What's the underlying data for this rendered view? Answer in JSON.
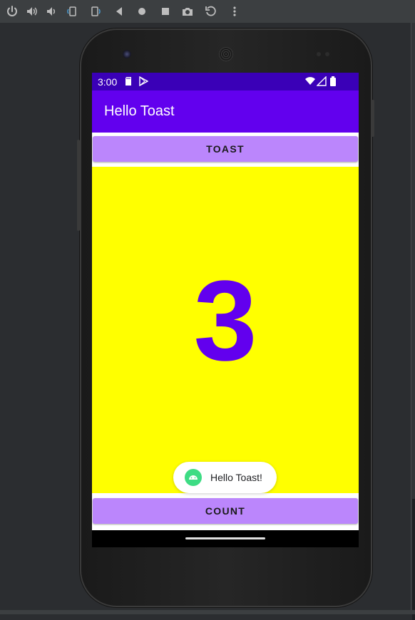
{
  "emulator_toolbar": {
    "icons": [
      "power-icon",
      "volume-up-icon",
      "volume-down-icon",
      "rotate-left-icon",
      "rotate-right-icon",
      "back-icon",
      "home-icon",
      "overview-icon",
      "camera-icon",
      "replay-icon",
      "more-icon"
    ]
  },
  "status_bar": {
    "time": "3:00",
    "icons": [
      "sd-card-icon",
      "play-store-icon",
      "wifi-icon",
      "signal-icon",
      "battery-icon"
    ]
  },
  "app_bar": {
    "title": "Hello Toast"
  },
  "toast_button": {
    "label": "TOAST"
  },
  "counter": {
    "value": "3"
  },
  "toast_message": {
    "text": "Hello Toast!",
    "icon": "android-icon"
  },
  "count_button": {
    "label": "COUNT"
  },
  "colors": {
    "status_bar": "#3a00b7",
    "app_bar": "#6200ee",
    "button": "#bb86fc",
    "count_background": "#ffff00",
    "count_text": "#6200ee",
    "toast_icon": "#3ddc84"
  }
}
